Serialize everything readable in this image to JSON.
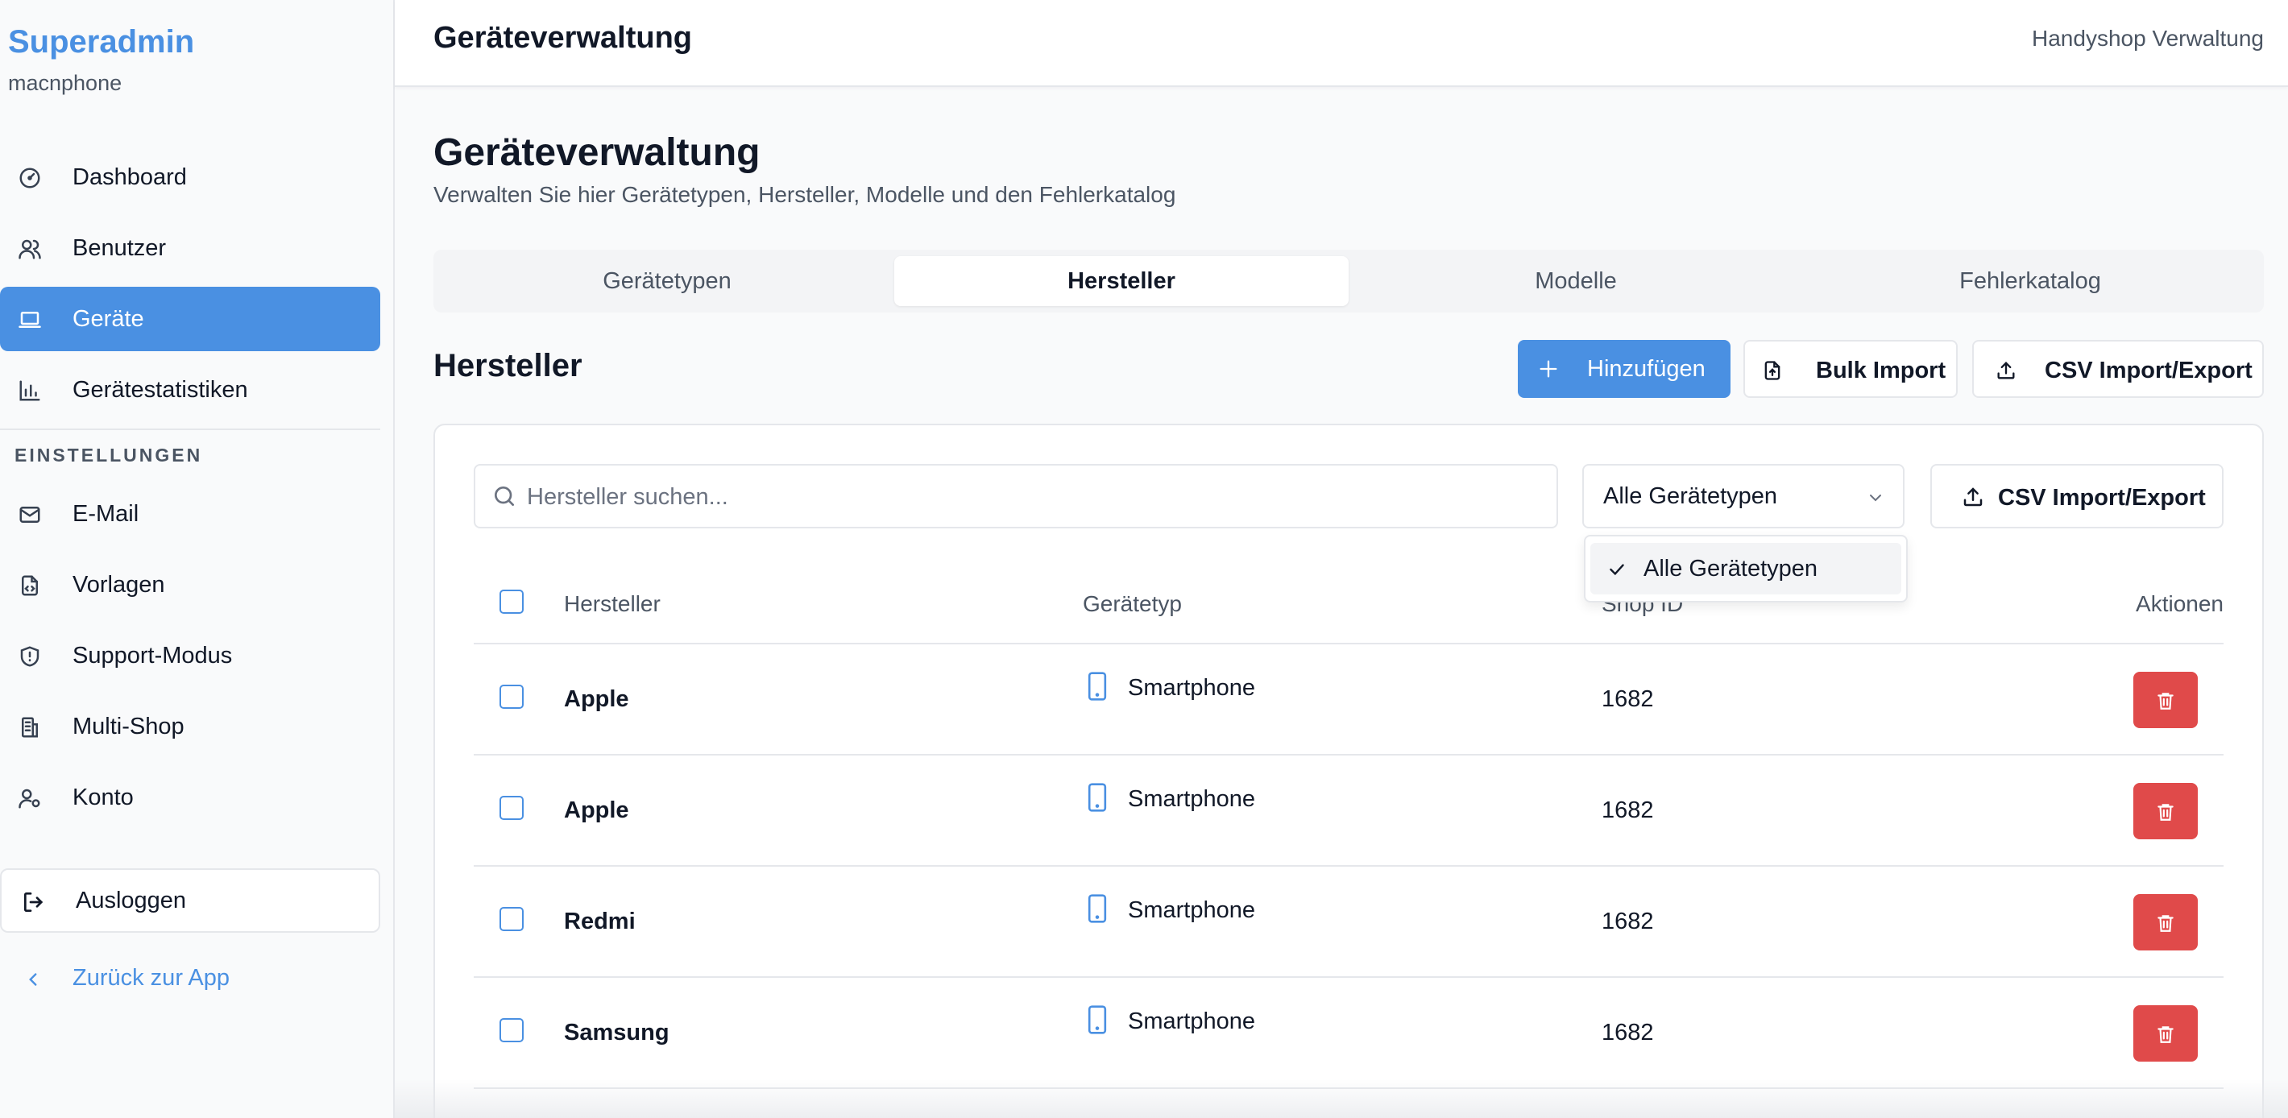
{
  "sidebar": {
    "brand": "Superadmin",
    "brand_sub": "macnphone",
    "items": [
      {
        "label": "Dashboard",
        "icon": "gauge-icon"
      },
      {
        "label": "Benutzer",
        "icon": "users-icon"
      },
      {
        "label": "Geräte",
        "icon": "laptop-icon",
        "active": true
      },
      {
        "label": "Gerätestatistiken",
        "icon": "bar-chart-icon"
      }
    ],
    "section_label": "EINSTELLUNGEN",
    "settings": [
      {
        "label": "E-Mail",
        "icon": "mail-icon"
      },
      {
        "label": "Vorlagen",
        "icon": "file-code-icon"
      },
      {
        "label": "Support-Modus",
        "icon": "shield-icon"
      },
      {
        "label": "Multi-Shop",
        "icon": "building-icon"
      },
      {
        "label": "Konto",
        "icon": "user-cog-icon"
      }
    ],
    "logout": "Ausloggen",
    "back": "Zurück zur App"
  },
  "header": {
    "title": "Geräteverwaltung",
    "right": "Handyshop Verwaltung"
  },
  "main": {
    "title": "Geräteverwaltung",
    "subtitle": "Verwalten Sie hier Gerätetypen, Hersteller, Modelle und den Fehlerkatalog",
    "tabs": [
      {
        "label": "Gerätetypen"
      },
      {
        "label": "Hersteller",
        "active": true
      },
      {
        "label": "Modelle"
      },
      {
        "label": "Fehlerkatalog"
      }
    ],
    "section_title": "Hersteller",
    "buttons": {
      "add": "Hinzufügen",
      "bulk": "Bulk Import",
      "csv": "CSV Import/Export"
    }
  },
  "filters": {
    "search_placeholder": "Hersteller suchen...",
    "search_value": "",
    "select_value": "Alle Gerätetypen",
    "csv_label": "CSV Import/Export",
    "dropdown_options": [
      "Alle Gerätetypen"
    ]
  },
  "table": {
    "columns": [
      "Hersteller",
      "Gerätetyp",
      "Shop ID",
      "Aktionen"
    ],
    "rows": [
      {
        "name": "Apple",
        "type": "Smartphone",
        "shop_id": "1682"
      },
      {
        "name": "Apple",
        "type": "Smartphone",
        "shop_id": "1682"
      },
      {
        "name": "Redmi",
        "type": "Smartphone",
        "shop_id": "1682"
      },
      {
        "name": "Samsung",
        "type": "Smartphone",
        "shop_id": "1682"
      }
    ]
  },
  "colors": {
    "accent": "#4a90e2",
    "danger": "#e04a4a",
    "border": "#e5e7eb",
    "muted_text": "#4b5563"
  }
}
